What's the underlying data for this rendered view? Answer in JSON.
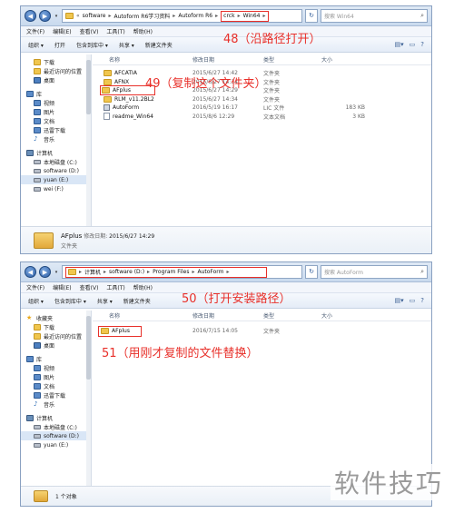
{
  "window1": {
    "nav_back": "◀",
    "nav_forward": "▶",
    "address": {
      "prefix": "«",
      "crumbs": [
        "software",
        "Autoform R6学习资料",
        "Autoform R6"
      ],
      "boxed_crumbs": [
        "crck",
        "Win64"
      ]
    },
    "search_placeholder": "搜索 Win64",
    "menu": [
      "文件(F)",
      "编辑(E)",
      "查看(V)",
      "工具(T)",
      "帮助(H)"
    ],
    "toolbar": [
      "组织 ▾",
      "打开",
      "包含到库中 ▾",
      "共享 ▾",
      "新建文件夹"
    ],
    "nav_items": [
      {
        "label": "下载",
        "icon": "download-folder-icon",
        "level": "child"
      },
      {
        "label": "最近访问的位置",
        "icon": "recent-places-icon",
        "level": "child"
      },
      {
        "label": "桌面",
        "icon": "desktop-icon",
        "level": "child"
      },
      {
        "label": "库",
        "icon": "library-icon",
        "level": "top"
      },
      {
        "label": "视频",
        "icon": "video-icon",
        "level": "child"
      },
      {
        "label": "图片",
        "icon": "pictures-icon",
        "level": "child"
      },
      {
        "label": "文档",
        "icon": "documents-icon",
        "level": "child"
      },
      {
        "label": "迅雷下载",
        "icon": "thunder-download-icon",
        "level": "child"
      },
      {
        "label": "音乐",
        "icon": "music-icon",
        "level": "child"
      },
      {
        "label": "计算机",
        "icon": "computer-icon",
        "level": "top"
      },
      {
        "label": "本地磁盘 (C:)",
        "icon": "drive-icon",
        "level": "child"
      },
      {
        "label": "software (D:)",
        "icon": "drive-icon",
        "level": "child"
      },
      {
        "label": "yuan (E:)",
        "icon": "drive-icon",
        "level": "child"
      },
      {
        "label": "wei (F:)",
        "icon": "drive-icon",
        "level": "child"
      }
    ],
    "columns": {
      "name": "名称",
      "date": "修改日期",
      "type": "类型",
      "size": "大小"
    },
    "files": [
      {
        "name": "AFCATIA",
        "date": "2015/6/27 14:42",
        "type": "文件夹",
        "size": "",
        "kind": "folder"
      },
      {
        "name": "AFNX",
        "date": "2015/6/27 14:34",
        "type": "文件夹",
        "size": "",
        "kind": "folder"
      },
      {
        "name": "AFplus",
        "date": "2015/6/27 14:29",
        "type": "文件夹",
        "size": "",
        "kind": "folder"
      },
      {
        "name": "RLM_v11.2BL2",
        "date": "2015/6/27 14:34",
        "type": "文件夹",
        "size": "",
        "kind": "folder"
      },
      {
        "name": "AutoForm",
        "date": "2016/5/19 16:17",
        "type": "LIC 文件",
        "size": "183 KB",
        "kind": "file"
      },
      {
        "name": "readme_Win64",
        "date": "2015/8/6 12:29",
        "type": "文本文档",
        "size": "3 KB",
        "kind": "file"
      }
    ],
    "details": {
      "name": "AFplus",
      "date_label": "修改日期:",
      "date": "2015/6/27 14:29",
      "type": "文件夹"
    },
    "annotations": {
      "a48": "48（沿路径打开）",
      "a49": "49（复制这个文件夹）"
    }
  },
  "window2": {
    "nav_back": "◀",
    "nav_forward": "▶",
    "address": {
      "prefix": "▸",
      "crumbs": [
        "计算机",
        "software (D:)",
        "Program Files",
        "AutoForm"
      ]
    },
    "search_placeholder": "搜索 AutoForm",
    "menu": [
      "文件(F)",
      "编辑(E)",
      "查看(V)",
      "工具(T)",
      "帮助(H)"
    ],
    "toolbar": [
      "组织 ▾",
      "包含到库中 ▾",
      "共享 ▾",
      "新建文件夹"
    ],
    "nav_items": [
      {
        "label": "收藏夹",
        "icon": "favorites-star-icon",
        "level": "top"
      },
      {
        "label": "下载",
        "icon": "download-folder-icon",
        "level": "child"
      },
      {
        "label": "最近访问的位置",
        "icon": "recent-places-icon",
        "level": "child"
      },
      {
        "label": "桌面",
        "icon": "desktop-icon",
        "level": "child"
      },
      {
        "label": "库",
        "icon": "library-icon",
        "level": "top"
      },
      {
        "label": "视频",
        "icon": "video-icon",
        "level": "child"
      },
      {
        "label": "图片",
        "icon": "pictures-icon",
        "level": "child"
      },
      {
        "label": "文档",
        "icon": "documents-icon",
        "level": "child"
      },
      {
        "label": "迅雷下载",
        "icon": "thunder-download-icon",
        "level": "child"
      },
      {
        "label": "音乐",
        "icon": "music-icon",
        "level": "child"
      },
      {
        "label": "计算机",
        "icon": "computer-icon",
        "level": "top"
      },
      {
        "label": "本地磁盘 (C:)",
        "icon": "drive-icon",
        "level": "child"
      },
      {
        "label": "software (D:)",
        "icon": "drive-icon",
        "level": "child"
      },
      {
        "label": "yuan (E:)",
        "icon": "drive-icon",
        "level": "child"
      }
    ],
    "columns": {
      "name": "名称",
      "date": "修改日期",
      "type": "类型",
      "size": "大小"
    },
    "files": [
      {
        "name": "AFplus",
        "date": "2016/7/15 14:05",
        "type": "文件夹",
        "size": "",
        "kind": "folder"
      }
    ],
    "details": {
      "count": "1 个对象"
    },
    "annotations": {
      "a50": "50（打开安装路径）",
      "a51": "51（用刚才复制的文件替换）"
    }
  },
  "watermark": "软件技巧",
  "colors": {
    "annotation": "#e8302a",
    "folder": "#f0c64e",
    "selection": "#d9e6f6"
  }
}
